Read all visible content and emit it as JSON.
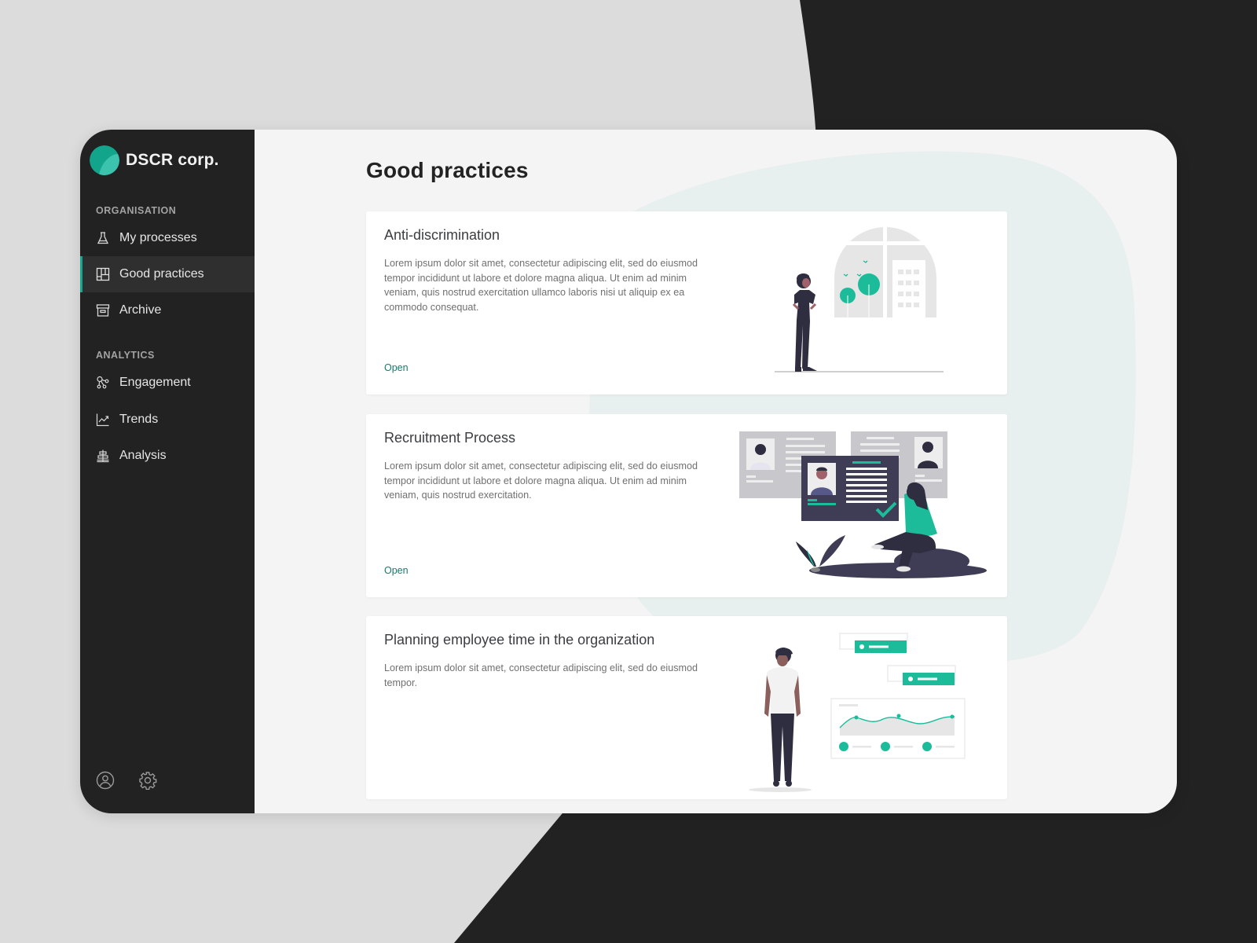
{
  "app": {
    "brand_name": "DSCR corp.",
    "brand_logo": "brand-logo-circle",
    "accent_color": "#16a88f",
    "link_color": "#127d6b"
  },
  "sidebar": {
    "sections": [
      {
        "label": "ORGANISATION",
        "items": [
          {
            "label": "My processes",
            "icon": "flask-icon",
            "active": false
          },
          {
            "label": "Good practices",
            "icon": "layout-grid-icon",
            "active": true
          },
          {
            "label": "Archive",
            "icon": "archive-box-icon",
            "active": false
          }
        ]
      },
      {
        "label": "ANALYTICS",
        "items": [
          {
            "label": "Engagement",
            "icon": "network-nodes-icon",
            "active": false
          },
          {
            "label": "Trends",
            "icon": "trend-chart-icon",
            "active": false
          },
          {
            "label": "Analysis",
            "icon": "analysis-hierarchy-icon",
            "active": false
          }
        ]
      }
    ],
    "footer": [
      {
        "icon": "user-profile-icon"
      },
      {
        "icon": "gear-icon"
      }
    ]
  },
  "main": {
    "title": "Good practices",
    "cards": [
      {
        "title": "Anti-discrimination",
        "description": "Lorem ipsum dolor sit amet, consectetur adipiscing elit, sed do eiusmod tempor incididunt ut labore et dolore magna aliqua. Ut enim ad minim veniam, quis nostrud exercitation ullamco laboris nisi ut aliquip ex ea commodo consequat.",
        "link": "Open",
        "illustration": "woman-looking-at-window-illustration"
      },
      {
        "title": "Recruitment Process",
        "description": "Lorem ipsum dolor sit amet, consectetur adipiscing elit, sed do eiusmod tempor incididunt ut labore et dolore magna aliqua. Ut enim ad minim veniam, quis nostrud exercitation.",
        "link": "Open",
        "illustration": "candidate-profiles-illustration"
      },
      {
        "title": "Planning employee time in the organization",
        "description": "Lorem ipsum dolor sit amet, consectetur adipiscing elit, sed do eiusmod tempor.",
        "illustration": "man-with-dashboard-illustration"
      }
    ]
  }
}
